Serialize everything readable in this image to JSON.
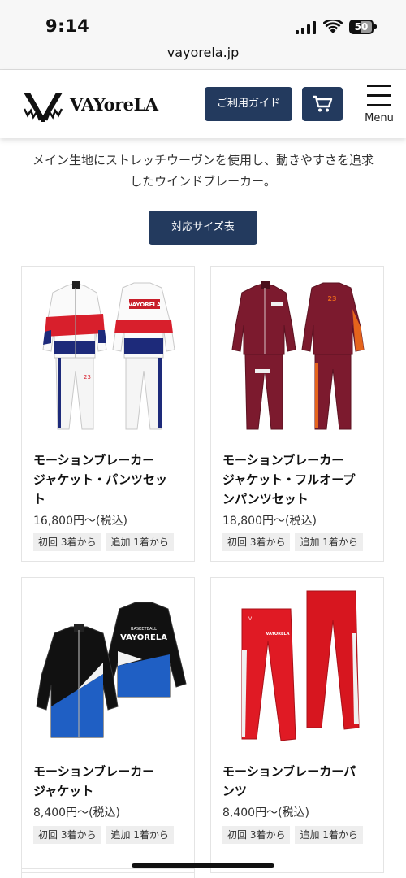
{
  "status_bar": {
    "time": "9:14",
    "battery": "50"
  },
  "browser": {
    "url": "vayorela.jp"
  },
  "header": {
    "logo_text": "VAYoreLA",
    "guide_label": "ご利用ガイド",
    "menu_label": "Menu",
    "accent_color": "#233a5e"
  },
  "intro": {
    "line1": "メイン生地にストレッチウーヴンを使用し、動きやすさを追求",
    "line2": "したウインドブレーカー。",
    "size_chart_label": "対応サイズ表"
  },
  "products": [
    {
      "name": [
        "モーションブレーカー",
        "ジャケット・パンツセッ",
        "ト"
      ],
      "price": "16,800円〜(税込)",
      "tags": [
        "初回 3着から",
        "追加 1着から"
      ],
      "print": {
        "brand": "VAYORELA",
        "number": "23"
      }
    },
    {
      "name": [
        "モーションブレーカー",
        "ジャケット・フルオープ",
        "ンパンツセット"
      ],
      "price": "18,800円〜(税込)",
      "tags": [
        "初回 3着から",
        "追加 1着から"
      ],
      "print": {
        "number": "23"
      }
    },
    {
      "name": [
        "モーションブレーカー",
        "ジャケット"
      ],
      "price": "8,400円〜(税込)",
      "tags": [
        "初回 3着から",
        "追加 1着から"
      ],
      "print": {
        "sub": "BASKETBALL",
        "brand": "VAYORELA"
      }
    },
    {
      "name": [
        "モーションブレーカーパ",
        "ンツ"
      ],
      "price": "8,400円〜(税込)",
      "tags": [
        "初回 3着から",
        "追加 1着から"
      ],
      "print": {
        "brand": "VAYORELA"
      }
    }
  ]
}
